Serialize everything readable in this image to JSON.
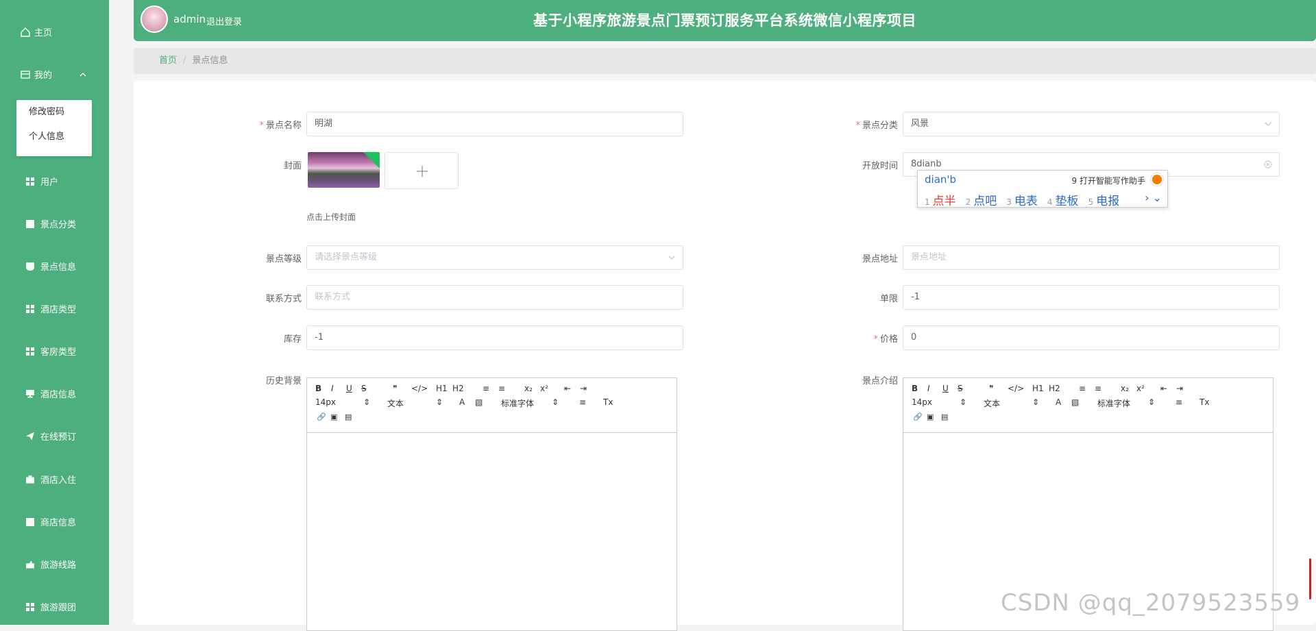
{
  "app": {
    "title": "基于小程序旅游景点门票预订服务平台系统微信小程序项目",
    "user": "admin",
    "logout": "退出登录",
    "accent": "#4caf7d"
  },
  "sidebar": {
    "home": "主页",
    "mine": "我的",
    "submenu": [
      "修改密码",
      "个人信息"
    ],
    "items": [
      {
        "label": "用户",
        "icon": "grid-icon"
      },
      {
        "label": "景点分类",
        "icon": "clipboard-icon"
      },
      {
        "label": "景点信息",
        "icon": "cup-icon"
      },
      {
        "label": "酒店类型",
        "icon": "grid-icon"
      },
      {
        "label": "客房类型",
        "icon": "grid-icon"
      },
      {
        "label": "酒店信息",
        "icon": "monitor-icon"
      },
      {
        "label": "在线预订",
        "icon": "send-icon"
      },
      {
        "label": "酒店入住",
        "icon": "briefcase-icon"
      },
      {
        "label": "商店信息",
        "icon": "building-icon"
      },
      {
        "label": "旅游线路",
        "icon": "hand-icon"
      },
      {
        "label": "旅游跟团",
        "icon": "grid-icon"
      }
    ]
  },
  "breadcrumb": {
    "home": "首页",
    "current": "景点信息"
  },
  "form": {
    "name_label": "景点名称",
    "name_value": "明湖",
    "category_label": "景点分类",
    "category_value": "风景",
    "cover_label": "封面",
    "cover_hint": "点击上传封面",
    "open_label": "开放时间",
    "open_value": "8dianb",
    "level_label": "景点等级",
    "level_placeholder": "请选择景点等级",
    "address_label": "景点地址",
    "address_placeholder": "景点地址",
    "contact_label": "联系方式",
    "contact_placeholder": "联系方式",
    "limit_label": "单限",
    "limit_value": "-1",
    "stock_label": "库存",
    "stock_value": "-1",
    "price_label": "价格",
    "price_value": "0",
    "history_label": "历史背景",
    "intro_label": "景点介绍"
  },
  "editor": {
    "font_size": "14px",
    "header_type": "文本",
    "font_family": "标准字体",
    "buttons": [
      "B",
      "I",
      "U",
      "S",
      "❞",
      "</>",
      "H1",
      "H2",
      "≡",
      "≡",
      "x₂",
      "x²",
      "⇤",
      "⇥"
    ]
  },
  "ime": {
    "pinyin": "dian'b",
    "ai_hint": "9 打开智能写作助手",
    "candidates": [
      "点半",
      "点吧",
      "电表",
      "垫板",
      "电报"
    ]
  },
  "watermark": "CSDN @qq_2079523559"
}
